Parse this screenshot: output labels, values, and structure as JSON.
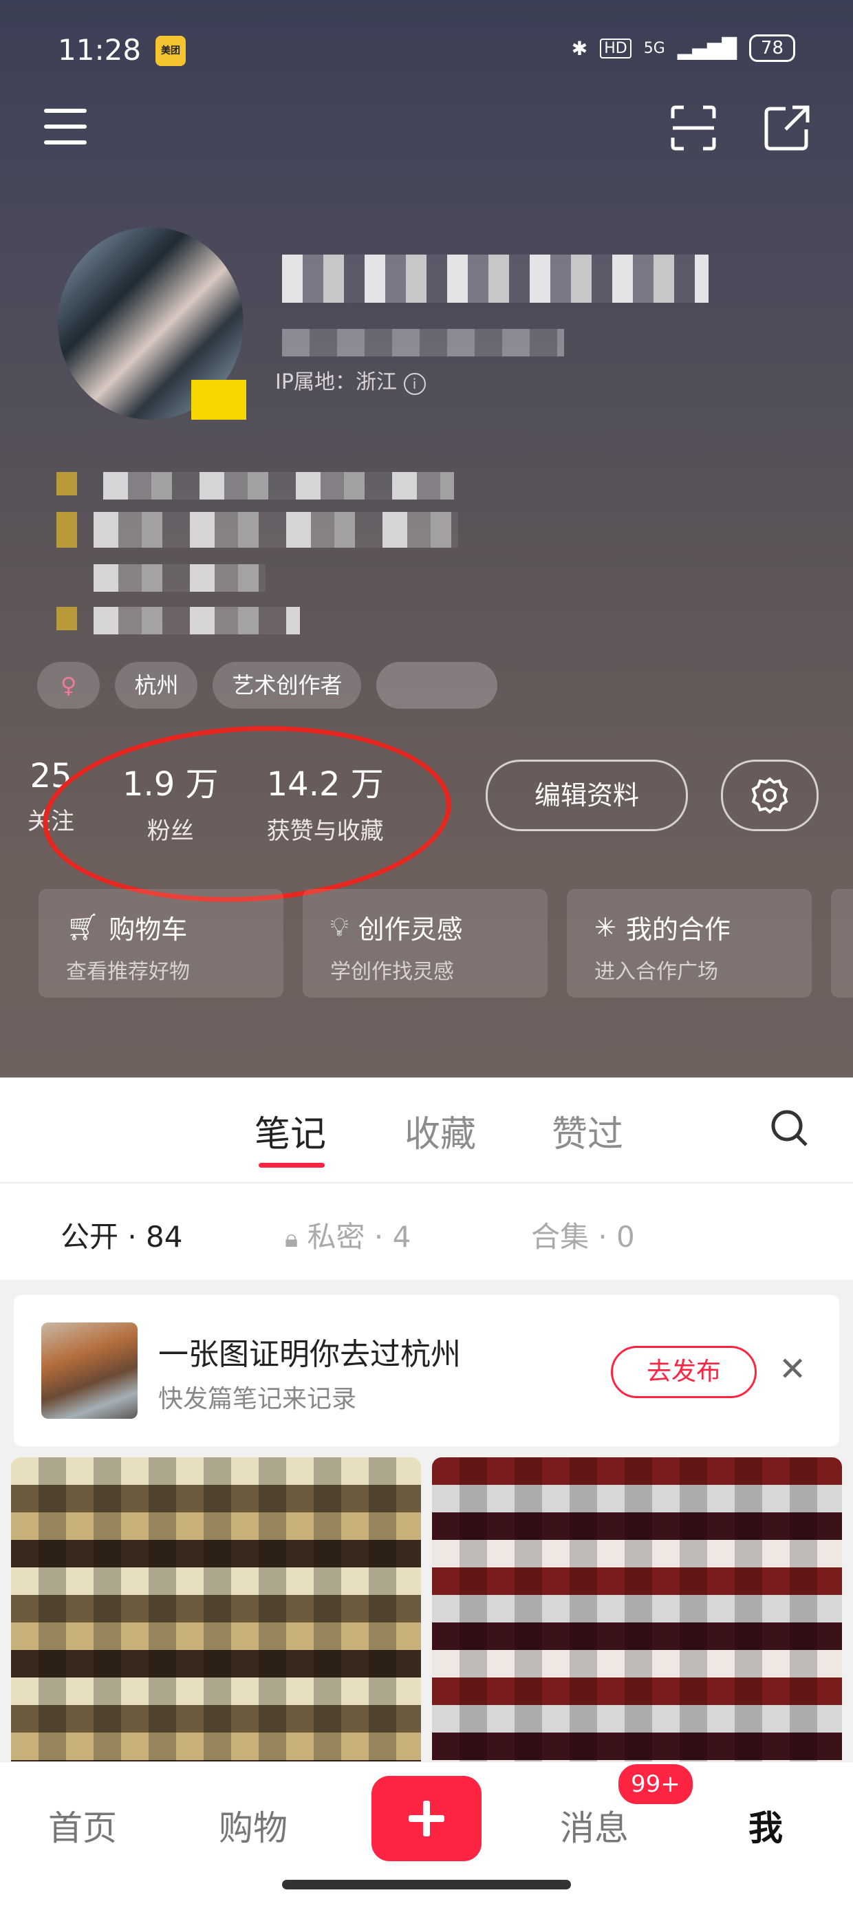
{
  "status_bar": {
    "time": "11:28",
    "app_icon": "美团",
    "network": "5G",
    "battery": "78"
  },
  "profile": {
    "ip_location": "IP属地：浙江",
    "tags": [
      "杭州",
      "艺术创作者"
    ],
    "stats": [
      {
        "value": "25",
        "label": "关注"
      },
      {
        "value": "1.9 万",
        "label": "粉丝"
      },
      {
        "value": "14.2 万",
        "label": "获赞与收藏"
      }
    ],
    "edit_label": "编辑资料"
  },
  "cards": [
    {
      "title": "购物车",
      "sub": "查看推荐好物"
    },
    {
      "title": "创作灵感",
      "sub": "学创作找灵感"
    },
    {
      "title": "我的合作",
      "sub": "进入合作广场"
    }
  ],
  "tabs": [
    "笔记",
    "收藏",
    "赞过"
  ],
  "subtabs": [
    {
      "label": "公开 · 84"
    },
    {
      "label": "私密 · 4"
    },
    {
      "label": "合集 · 0"
    }
  ],
  "prompt": {
    "title": "一张图证明你去过杭州",
    "sub": "快发篇笔记来记录",
    "button": "去发布"
  },
  "bottom_nav": {
    "home": "首页",
    "shop": "购物",
    "messages": "消息",
    "badge": "99+",
    "me": "我"
  },
  "colors": {
    "accent": "#ff2442",
    "annotation": "#e6261f"
  }
}
